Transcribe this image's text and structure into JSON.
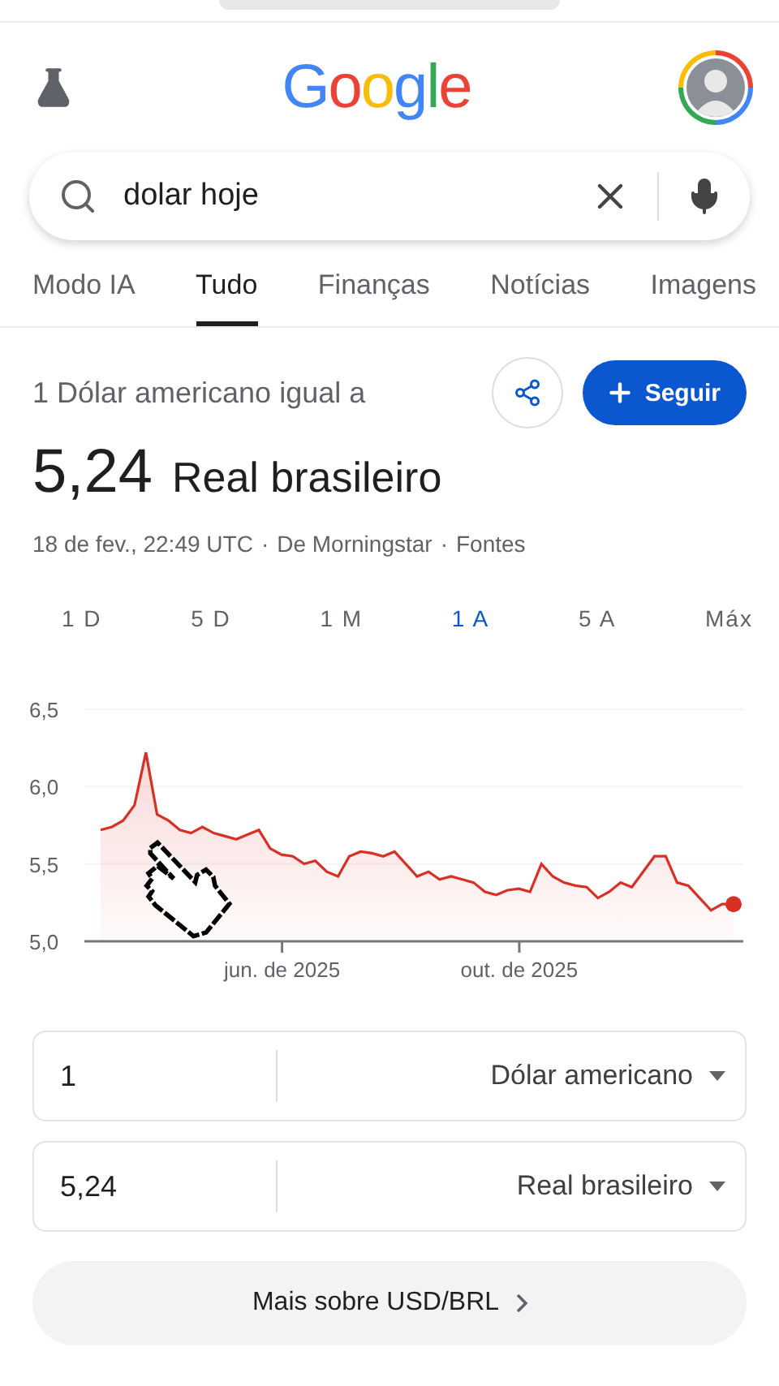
{
  "header": {
    "logo": "Google"
  },
  "search": {
    "value": "dolar hoje"
  },
  "tabs": [
    {
      "label": "Modo IA",
      "selected": false
    },
    {
      "label": "Tudo",
      "selected": true
    },
    {
      "label": "Finanças",
      "selected": false
    },
    {
      "label": "Notícias",
      "selected": false
    },
    {
      "label": "Imagens",
      "selected": false
    }
  ],
  "rate": {
    "caption": "1 Dólar americano igual a",
    "follow_label": "Seguir",
    "value": "5,24",
    "currency": "Real brasileiro",
    "meta": [
      "18 de fev., 22:49 UTC",
      "De Morningstar",
      "Fontes"
    ],
    "meta_separator": "·"
  },
  "ranges": [
    {
      "label": "1 D",
      "selected": false
    },
    {
      "label": "5 D",
      "selected": false
    },
    {
      "label": "1 M",
      "selected": false
    },
    {
      "label": "1 A",
      "selected": true
    },
    {
      "label": "5 A",
      "selected": false
    },
    {
      "label": "Máx",
      "selected": false
    }
  ],
  "chart": {
    "axis_labels": [
      "jun. de 2025",
      "out. de 2025"
    ],
    "chart_data": {
      "type": "area",
      "ylim": [
        5.0,
        6.5
      ],
      "yticks": [
        {
          "value": 5.0,
          "label": "5,0"
        },
        {
          "value": 5.5,
          "label": "5,5"
        },
        {
          "value": 6.0,
          "label": "6,0"
        },
        {
          "value": 6.5,
          "label": "6,5"
        }
      ],
      "series": [
        {
          "color": "#d93025",
          "values": [
            5.72,
            5.74,
            5.78,
            5.88,
            6.22,
            5.82,
            5.78,
            5.72,
            5.7,
            5.74,
            5.7,
            5.68,
            5.66,
            5.69,
            5.72,
            5.6,
            5.56,
            5.55,
            5.5,
            5.52,
            5.45,
            5.42,
            5.55,
            5.58,
            5.57,
            5.55,
            5.58,
            5.5,
            5.42,
            5.45,
            5.4,
            5.42,
            5.4,
            5.38,
            5.32,
            5.3,
            5.33,
            5.34,
            5.32,
            5.5,
            5.42,
            5.38,
            5.36,
            5.35,
            5.28,
            5.32,
            5.38,
            5.35,
            5.45,
            5.55,
            5.55,
            5.38,
            5.36,
            5.28,
            5.2,
            5.24,
            5.24
          ]
        }
      ]
    }
  },
  "converter": [
    {
      "amount": "1",
      "currency": "Dólar americano"
    },
    {
      "amount": "5,24",
      "currency": "Real brasileiro"
    }
  ],
  "more_label": "Mais sobre USD/BRL"
}
